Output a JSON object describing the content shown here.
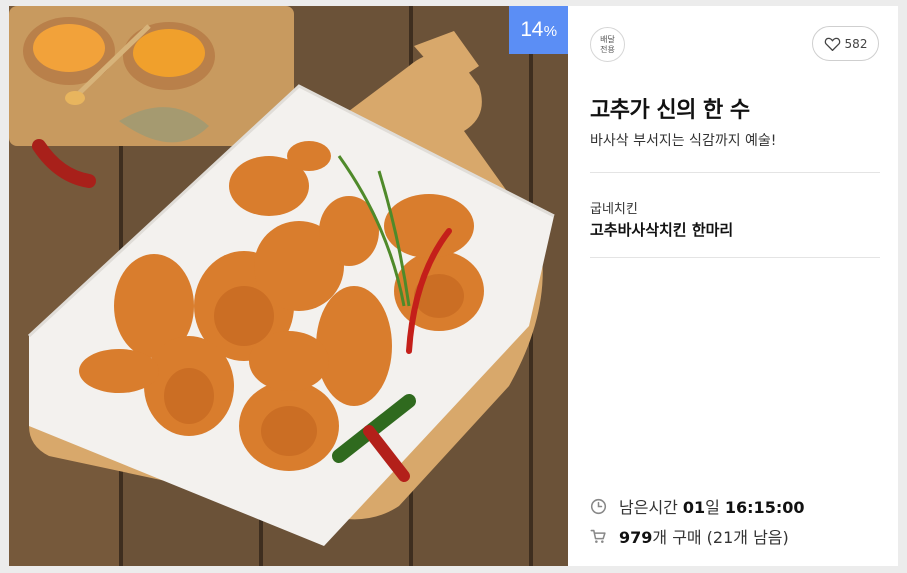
{
  "badge": {
    "discount_value": "14",
    "discount_unit": "%"
  },
  "delivery": {
    "line1": "배달",
    "line2": "전용"
  },
  "like": {
    "count": "582"
  },
  "deal": {
    "title": "고추가 신의 한 수",
    "subtitle": "바사삭 부서지는 식감까지 예술!",
    "store": "굽네치킨",
    "product": "고추바사삭치킨 한마리"
  },
  "remaining": {
    "label": "남은시간",
    "days": "01",
    "days_unit": "일",
    "time": "16:15:00"
  },
  "purchase": {
    "count": "979",
    "unit": "개 구매",
    "left": "(21개 남음)"
  },
  "colors": {
    "accent": "#5b8ef5",
    "text": "#111111",
    "muted": "#888888"
  },
  "icons": {
    "heart": "heart-icon",
    "clock": "clock-icon",
    "cart": "cart-icon"
  }
}
